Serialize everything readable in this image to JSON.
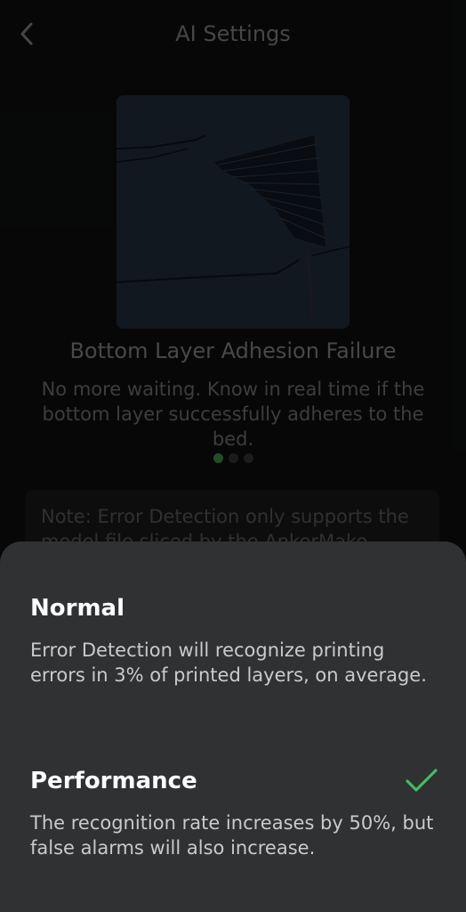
{
  "header": {
    "title": "AI Settings",
    "back_icon": "chevron-left-icon"
  },
  "carousel": {
    "feature_title": "Bottom Layer Adhesion Failure",
    "feature_description": "No more waiting. Know in real time if the bottom layer successfully adheres to the bed.",
    "page_count": 3,
    "active_index": 0,
    "active_color": "#2f7d3a"
  },
  "note": {
    "text": "Note: Error Detection only supports the model file sliced by the AnkerMake Slicer"
  },
  "sheet": {
    "options": [
      {
        "title": "Normal",
        "description": "Error Detection will recognize printing errors in 3% of printed layers, on average.",
        "selected": false
      },
      {
        "title": "Performance",
        "description": "The recognition rate increases by 50%, but false alarms will also increase.",
        "selected": true,
        "check_icon": "checkmark-icon",
        "check_color": "#3fbf5a"
      }
    ]
  }
}
